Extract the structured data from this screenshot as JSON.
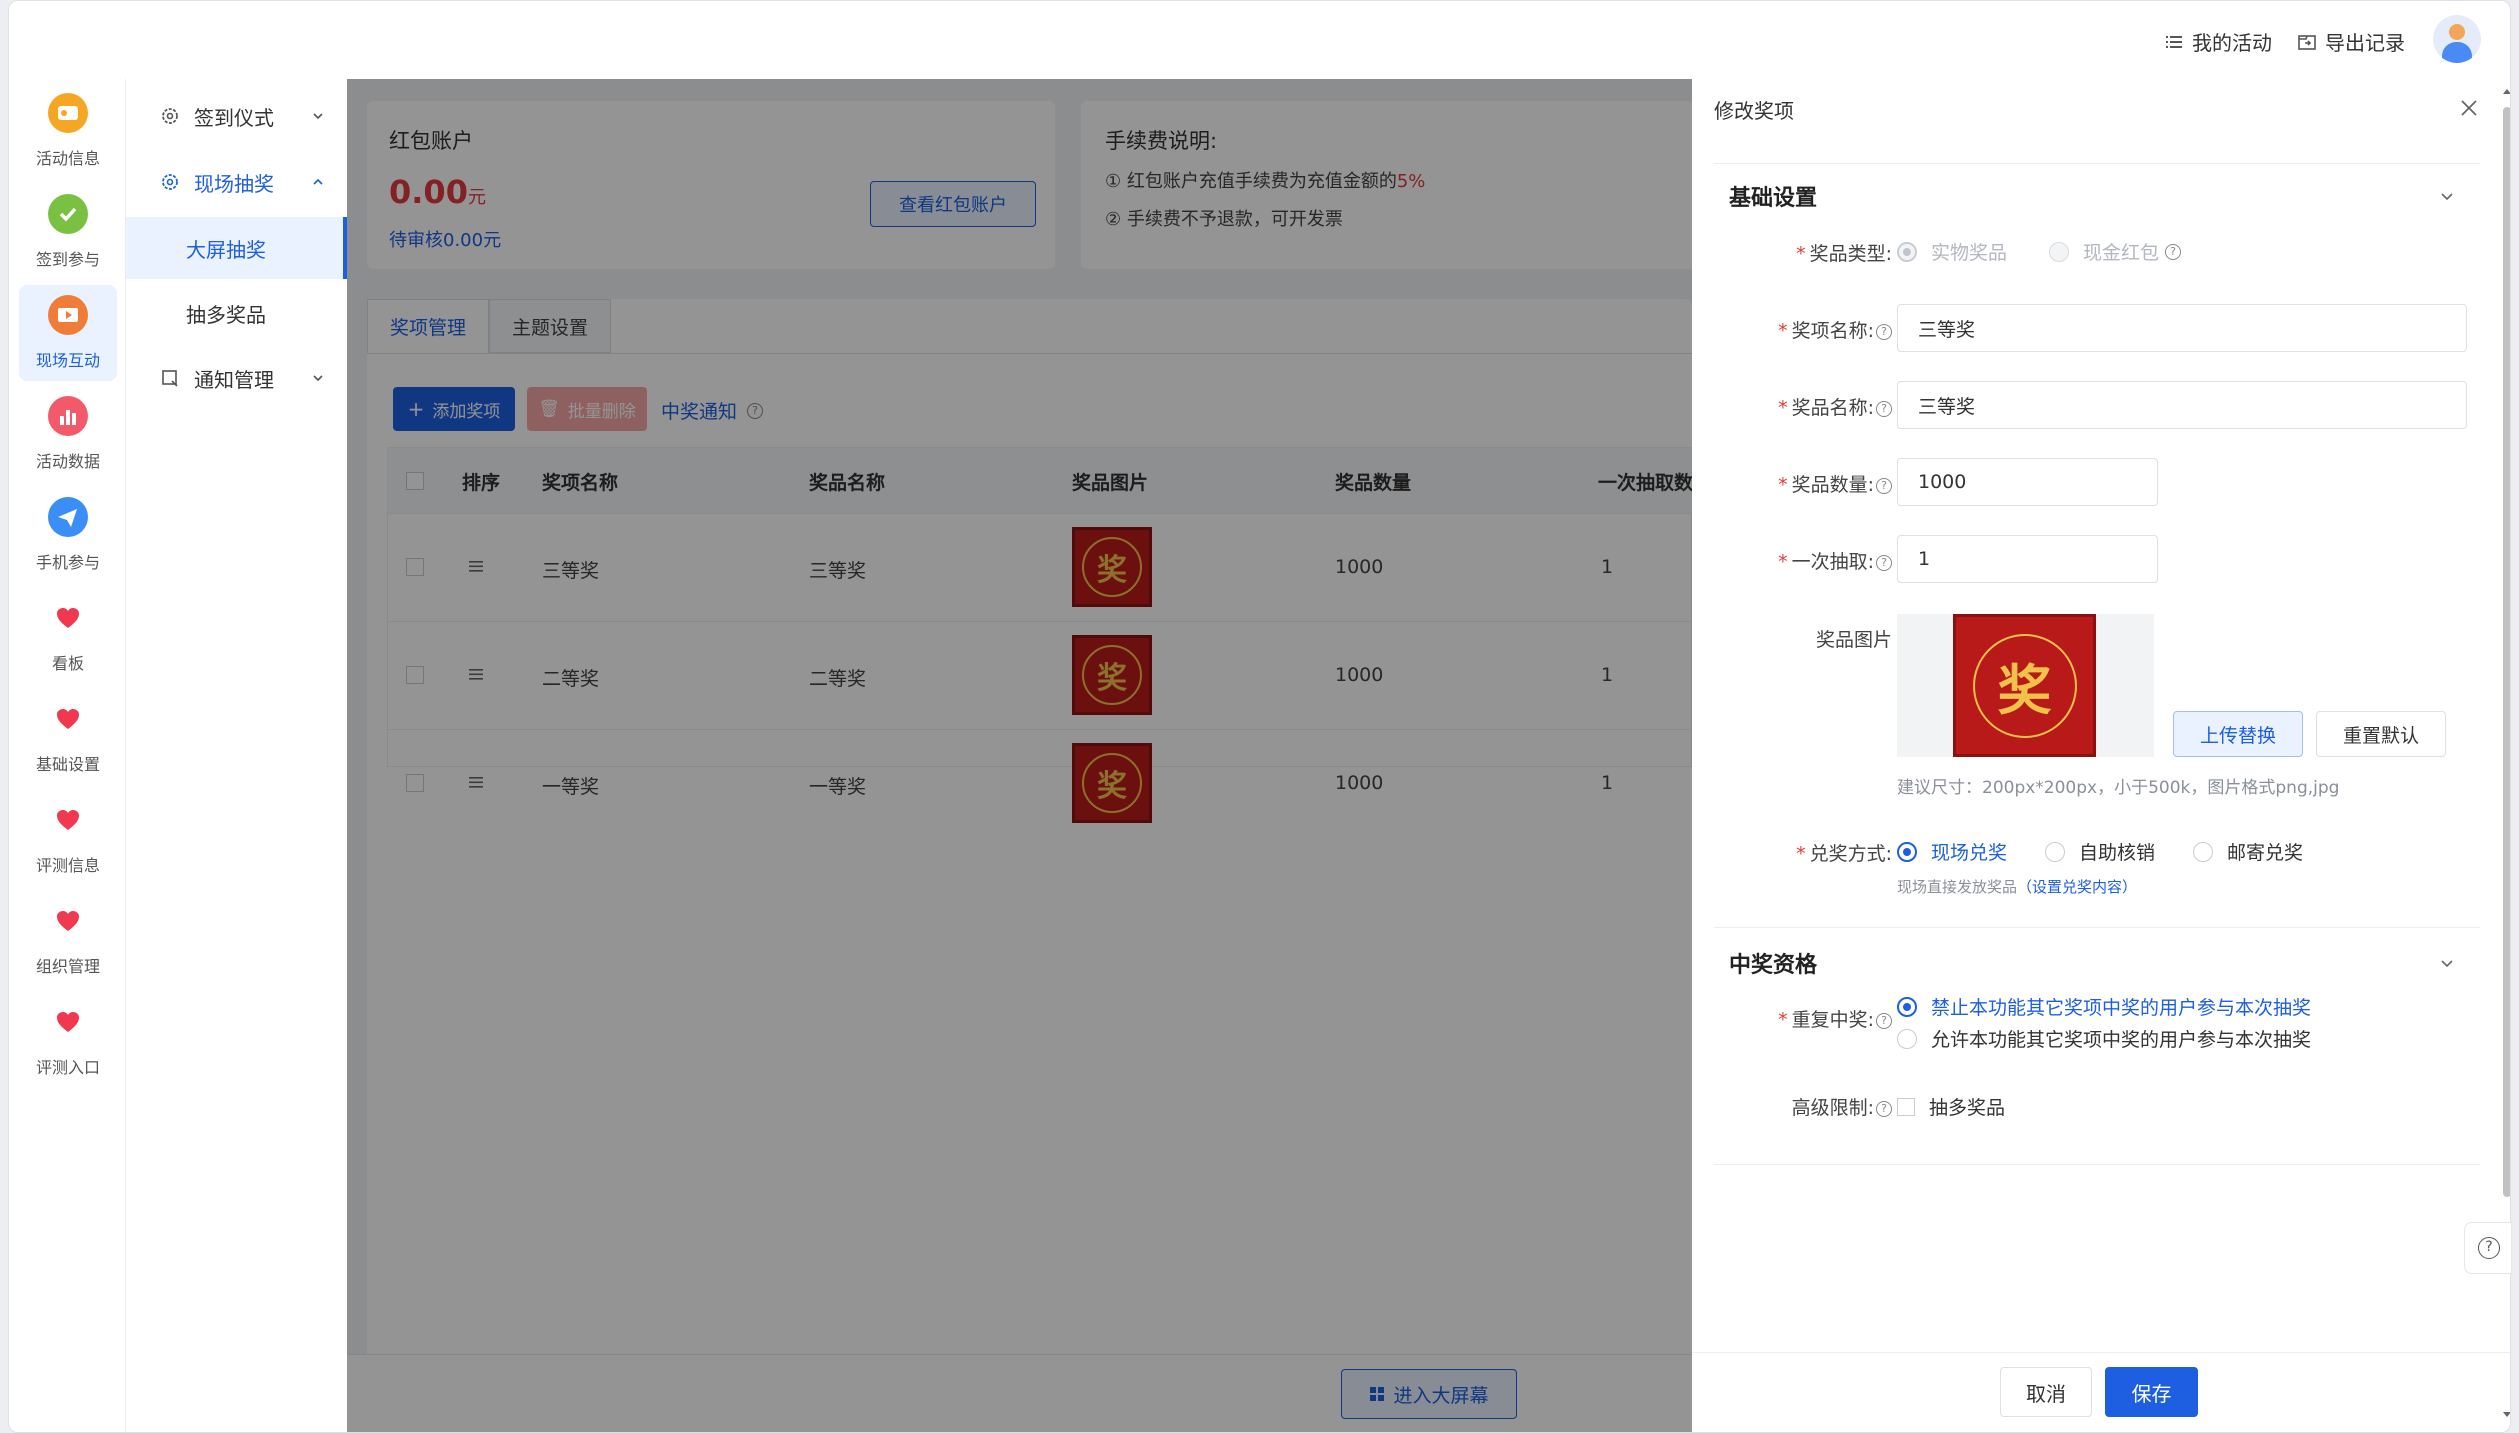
{
  "topbar": {
    "my_activity": "我的活动",
    "export_records": "导出记录"
  },
  "rail": [
    {
      "label": "活动信息",
      "icon": "activity-info-icon",
      "color": "#f5a623"
    },
    {
      "label": "签到参与",
      "icon": "checkin-icon",
      "color": "#7ac142"
    },
    {
      "label": "现场互动",
      "icon": "live-interaction-icon",
      "color": "#f07c3a"
    },
    {
      "label": "活动数据",
      "icon": "activity-data-icon",
      "color": "#f25a6a"
    },
    {
      "label": "手机参与",
      "icon": "mobile-participation-icon",
      "color": "#3a8ef6"
    },
    {
      "label": "看板",
      "icon": "heart-icon",
      "color": "#f0384f"
    },
    {
      "label": "基础设置",
      "icon": "heart-icon",
      "color": "#f0384f"
    },
    {
      "label": "评测信息",
      "icon": "heart-icon",
      "color": "#f0384f"
    },
    {
      "label": "组织管理",
      "icon": "heart-icon",
      "color": "#f0384f"
    },
    {
      "label": "评测入口",
      "icon": "heart-icon",
      "color": "#f0384f"
    }
  ],
  "submenu": {
    "checkin_ceremony": "签到仪式",
    "live_draw": "现场抽奖",
    "big_screen_draw": "大屏抽奖",
    "multi_prize_draw": "抽多奖品",
    "notice_mgmt": "通知管理"
  },
  "account": {
    "title": "红包账户",
    "amount": "0.00",
    "unit": "元",
    "pending": "待审核0.00元",
    "view_btn": "查看红包账户"
  },
  "fee": {
    "title": "手续费说明:",
    "line1_prefix": "① 红包账户充值手续费为充值金额的",
    "line1_rate": "5%",
    "line2": "② 手续费不予退款，可开发票"
  },
  "tabs": [
    "奖项管理",
    "主题设置"
  ],
  "toolbar": {
    "add": "添加奖项",
    "batch_delete": "批量删除",
    "notice": "中奖通知"
  },
  "table": {
    "headers": [
      "排序",
      "奖项名称",
      "奖品名称",
      "奖品图片",
      "奖品数量",
      "一次抽取数"
    ],
    "rows": [
      {
        "award": "三等奖",
        "prize": "三等奖",
        "qty": "1000",
        "draw": "1"
      },
      {
        "award": "二等奖",
        "prize": "二等奖",
        "qty": "1000",
        "draw": "1"
      },
      {
        "award": "一等奖",
        "prize": "一等奖",
        "qty": "1000",
        "draw": "1"
      }
    ]
  },
  "prize_glyph": "奖",
  "enter_screen": "进入大屏幕",
  "drawer": {
    "title": "修改奖项",
    "basic_section": "基础设置",
    "prize_type_label": "奖品类型:",
    "prize_type_options": [
      "实物奖品",
      "现金红包"
    ],
    "award_name_label": "奖项名称:",
    "award_name_value": "三等奖",
    "prize_name_label": "奖品名称:",
    "prize_name_value": "三等奖",
    "qty_label": "奖品数量:",
    "qty_value": "1000",
    "draw_label": "一次抽取:",
    "draw_value": "1",
    "image_label": "奖品图片",
    "upload_btn": "上传替换",
    "reset_btn": "重置默认",
    "image_hint": "建议尺寸：200px*200px，小于500k，图片格式png,jpg",
    "redeem_label": "兑奖方式:",
    "redeem_options": [
      "现场兑奖",
      "自助核销",
      "邮寄兑奖"
    ],
    "redeem_hint": "现场直接发放奖品",
    "redeem_link": "（设置兑奖内容）",
    "eligibility_section": "中奖资格",
    "repeat_label": "重复中奖:",
    "repeat_options": [
      "禁止本功能其它奖项中奖的用户参与本次抽奖",
      "允许本功能其它奖项中奖的用户参与本次抽奖"
    ],
    "advanced_label": "高级限制:",
    "advanced_option": "抽多奖品",
    "cancel": "取消",
    "save": "保存"
  },
  "colors": {
    "primary": "#1d5fe0",
    "danger": "#e4393c",
    "prize_red": "#b81a1a"
  }
}
